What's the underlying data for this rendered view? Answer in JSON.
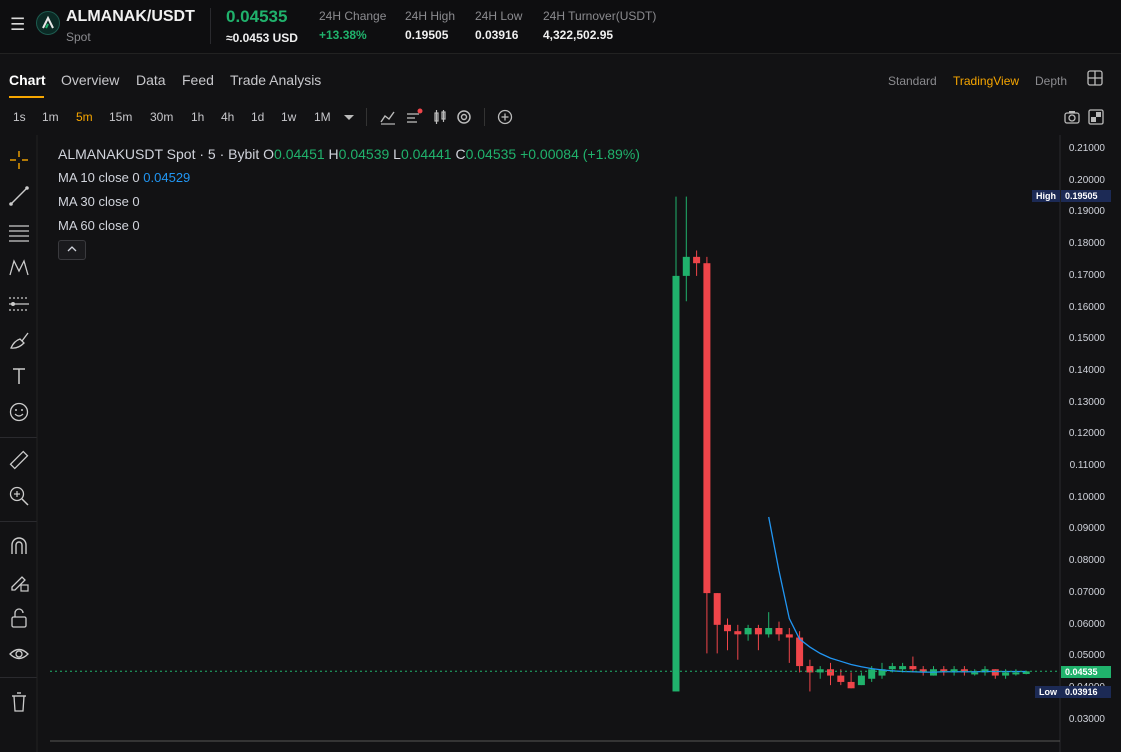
{
  "header": {
    "pair": "ALMANAK/USDT",
    "market": "Spot",
    "last_price": "0.04535",
    "last_price_usd": "≈0.0453 USD",
    "stats": [
      {
        "label": "24H Change",
        "value": "+13.38%"
      },
      {
        "label": "24H High",
        "value": "0.19505"
      },
      {
        "label": "24H Low",
        "value": "0.03916"
      },
      {
        "label": "24H Turnover(USDT)",
        "value": "4,322,502.95"
      }
    ]
  },
  "tabs": [
    "Chart",
    "Overview",
    "Data",
    "Feed",
    "Trade Analysis"
  ],
  "views": [
    "Standard",
    "TradingView",
    "Depth"
  ],
  "timeframes": [
    "1s",
    "1m",
    "5m",
    "15m",
    "30m",
    "1h",
    "4h",
    "1d",
    "1w",
    "1M"
  ],
  "legend": {
    "title": "ALMANAKUSDT Spot · 5 · Bybit",
    "o_label": "O",
    "o": "0.04451",
    "h_label": "H",
    "h": "0.04539",
    "l_label": "L",
    "l": "0.04441",
    "c_label": "C",
    "c": "0.04535",
    "change": "+0.00084 (+1.89%)",
    "ma10": "MA 10 close 0",
    "ma10_val": "0.04529",
    "ma30": "MA 30 close 0",
    "ma60": "MA 60 close 0"
  },
  "price_axis": {
    "ticks": [
      "0.21000",
      "0.20000",
      "0.19000",
      "0.18000",
      "0.17000",
      "0.16000",
      "0.15000",
      "0.14000",
      "0.13000",
      "0.12000",
      "0.11000",
      "0.10000",
      "0.09000",
      "0.08000",
      "0.07000",
      "0.06000",
      "0.05000",
      "0.04000",
      "0.03000"
    ],
    "high_label": "High",
    "high_value": "0.19505",
    "low_label": "Low",
    "low_value": "0.03916",
    "current_value": "0.04535"
  },
  "colors": {
    "up": "#20b26c",
    "down": "#ef454a",
    "accent": "#f7a600",
    "ma": "#2196f3",
    "badge_bg": "#1c2a55"
  },
  "chart_data": {
    "type": "candlestick",
    "ylim": [
      0.025,
      0.215
    ],
    "candles": [
      {
        "o": 0.039,
        "h": 0.195,
        "l": 0.039,
        "c": 0.17
      },
      {
        "o": 0.17,
        "h": 0.195,
        "l": 0.162,
        "c": 0.176
      },
      {
        "o": 0.176,
        "h": 0.178,
        "l": 0.17,
        "c": 0.174
      },
      {
        "o": 0.174,
        "h": 0.176,
        "l": 0.051,
        "c": 0.07
      },
      {
        "o": 0.07,
        "h": 0.07,
        "l": 0.051,
        "c": 0.06
      },
      {
        "o": 0.06,
        "h": 0.062,
        "l": 0.052,
        "c": 0.058
      },
      {
        "o": 0.058,
        "h": 0.06,
        "l": 0.049,
        "c": 0.057
      },
      {
        "o": 0.057,
        "h": 0.06,
        "l": 0.055,
        "c": 0.059
      },
      {
        "o": 0.059,
        "h": 0.06,
        "l": 0.052,
        "c": 0.057
      },
      {
        "o": 0.057,
        "h": 0.064,
        "l": 0.056,
        "c": 0.059
      },
      {
        "o": 0.059,
        "h": 0.061,
        "l": 0.055,
        "c": 0.057
      },
      {
        "o": 0.057,
        "h": 0.059,
        "l": 0.048,
        "c": 0.056
      },
      {
        "o": 0.056,
        "h": 0.058,
        "l": 0.045,
        "c": 0.047
      },
      {
        "o": 0.047,
        "h": 0.049,
        "l": 0.039,
        "c": 0.045
      },
      {
        "o": 0.045,
        "h": 0.047,
        "l": 0.043,
        "c": 0.046
      },
      {
        "o": 0.046,
        "h": 0.048,
        "l": 0.041,
        "c": 0.044
      },
      {
        "o": 0.044,
        "h": 0.046,
        "l": 0.041,
        "c": 0.042
      },
      {
        "o": 0.042,
        "h": 0.045,
        "l": 0.04,
        "c": 0.04
      },
      {
        "o": 0.041,
        "h": 0.045,
        "l": 0.041,
        "c": 0.044
      },
      {
        "o": 0.043,
        "h": 0.047,
        "l": 0.042,
        "c": 0.046
      },
      {
        "o": 0.044,
        "h": 0.048,
        "l": 0.043,
        "c": 0.046
      },
      {
        "o": 0.046,
        "h": 0.048,
        "l": 0.045,
        "c": 0.047
      },
      {
        "o": 0.046,
        "h": 0.048,
        "l": 0.045,
        "c": 0.047
      },
      {
        "o": 0.047,
        "h": 0.05,
        "l": 0.045,
        "c": 0.046
      },
      {
        "o": 0.046,
        "h": 0.047,
        "l": 0.044,
        "c": 0.045
      },
      {
        "o": 0.044,
        "h": 0.047,
        "l": 0.044,
        "c": 0.046
      },
      {
        "o": 0.046,
        "h": 0.047,
        "l": 0.044,
        "c": 0.045
      },
      {
        "o": 0.045,
        "h": 0.047,
        "l": 0.044,
        "c": 0.046
      },
      {
        "o": 0.046,
        "h": 0.047,
        "l": 0.044,
        "c": 0.045
      },
      {
        "o": 0.045,
        "h": 0.046,
        "l": 0.044,
        "c": 0.045
      },
      {
        "o": 0.045,
        "h": 0.047,
        "l": 0.044,
        "c": 0.046
      },
      {
        "o": 0.046,
        "h": 0.046,
        "l": 0.043,
        "c": 0.044
      },
      {
        "o": 0.044,
        "h": 0.046,
        "l": 0.043,
        "c": 0.045
      },
      {
        "o": 0.045,
        "h": 0.046,
        "l": 0.044,
        "c": 0.045
      },
      {
        "o": 0.0445,
        "h": 0.0454,
        "l": 0.0444,
        "c": 0.04535
      }
    ],
    "ma10": {
      "start_index": 9,
      "values": [
        0.094,
        0.077,
        0.062,
        0.0555,
        0.053,
        0.051,
        0.0495,
        0.0485,
        0.0475,
        0.0468,
        0.0462,
        0.0458,
        0.0455,
        0.0453,
        0.0452,
        0.0451,
        0.0451,
        0.0452,
        0.0452,
        0.0452,
        0.0452,
        0.0453,
        0.0453,
        0.0453,
        0.0453,
        0.04529
      ]
    }
  }
}
